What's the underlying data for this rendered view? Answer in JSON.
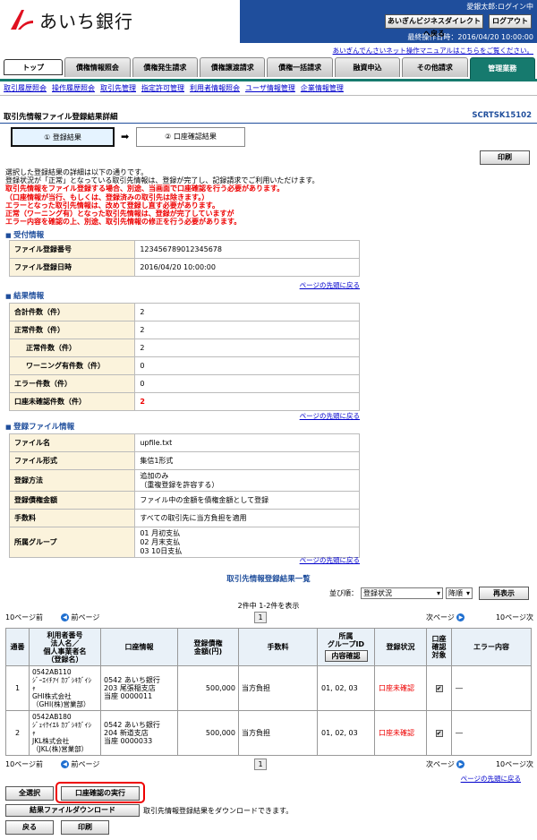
{
  "header": {
    "logo_text": "あいち銀行",
    "user": "愛銀太郎:ログイン中",
    "direct_btn": "あいぎんビジネスダイレクトへ戻る",
    "logout_btn": "ログアウト",
    "last_op": "最終操作日時：2016/04/20 10:00:00",
    "links": "あいぎんでんさいネット操作マニュアルはこちらをご覧ください。"
  },
  "tabs": [
    "トップ",
    "債権情報照会",
    "債権発生請求",
    "債権譲渡請求",
    "債権一括請求",
    "融資申込",
    "その他請求",
    "管理業務"
  ],
  "subnav": [
    "取引履歴照会",
    "操作履歴照会",
    "取引先管理",
    "指定許可管理",
    "利用者情報照会",
    "ユーザ情報管理",
    "企業情報管理"
  ],
  "page": {
    "title": "取引先情報ファイル登録結果詳細",
    "id": "SCRTSK15102",
    "step1": "① 登録結果",
    "step2": "② 口座確認結果",
    "print_btn": "印刷"
  },
  "intro": {
    "line1": "選択した登録結果の詳細は以下の通りです。",
    "line2": "登録状況が「正常」となっている取引先情報は、登録が完了し、記録請求でご利用いただけます。",
    "red1": "取引先情報をファイル登録する場合、別途、当画面で口座確認を行う必要があります。",
    "red2": "（口座情報が当行、もしくは、登録済みの取引先は除きます。）",
    "red3": "エラーとなった取引先情報は、改めて登録し直す必要があります。",
    "red4": "正常（ワーニング有）となった取引先情報は、登録が完了していますが",
    "red5": "エラー内容を確認の上、別途、取引先情報の修正を行う必要があります。"
  },
  "receipt": {
    "title": "受付情報",
    "rows": [
      {
        "k": "ファイル登録番号",
        "v": "123456789012345678"
      },
      {
        "k": "ファイル登録日時",
        "v": "2016/04/20 10:00:00"
      }
    ]
  },
  "top_link": "ページの先頭に戻る",
  "result": {
    "title": "結果情報",
    "rows": [
      {
        "k": "合計件数（件）",
        "v": "2"
      },
      {
        "k": "正常件数（件）",
        "v": "2"
      },
      {
        "k": "正常件数（件）",
        "v": "2"
      },
      {
        "k": "ワーニング有件数（件）",
        "v": "0"
      },
      {
        "k": "エラー件数（件）",
        "v": "0"
      },
      {
        "k": "口座未確認件数（件）",
        "v": "2"
      }
    ]
  },
  "file": {
    "title": "登録ファイル情報",
    "rows": [
      {
        "k": "ファイル名",
        "v": "upfile.txt"
      },
      {
        "k": "ファイル形式",
        "v": "集信1形式"
      },
      {
        "k": "登録方法",
        "v": "追加のみ",
        "v2": "（重複登録を許容する）"
      },
      {
        "k": "登録債権金額",
        "v": "ファイル中の金額を債権金額として登録"
      },
      {
        "k": "手数料",
        "v": "すべての取引先に当方負担を適用"
      },
      {
        "k": "所属グループ",
        "v": "01 月初支払",
        "v2": "02 月末支払",
        "v3": "03 10日支払"
      }
    ]
  },
  "list": {
    "title": "取引先情報登録結果一覧",
    "sort_label": "並び順：",
    "sort_value": "登録状況",
    "order_value": "降順",
    "resort_btn": "再表示",
    "count": "2件中 1-2件を表示",
    "prev10": "10ページ前",
    "prev": "前ページ",
    "page": "1",
    "next": "次ページ",
    "next10": "10ページ次",
    "headers": [
      "通番",
      "利用者番号\n法人名／\n個人事業者名\n（登録名）",
      "口座情報",
      "登録債権\n金額(円)",
      "手数料",
      "所属\nグループID",
      "登録状況",
      "口座\n確認\n対象",
      "エラー内容"
    ],
    "group_btn": "内容確認",
    "rows": [
      {
        "no": "1",
        "user": "0542AB110",
        "name1": "ｼﾞｰｴｲﾁｱｲ ｶﾌﾞｼｷｶﾞｲｼ",
        "name2": "ｬ",
        "name3": "GHI株式会社",
        "name4": "（GHI(株)営業部）",
        "acc1": "0542 あいち銀行",
        "acc2": "203 尾張稲支店",
        "acc3": "当座 0000011",
        "amount": "500,000",
        "fee": "当方負担",
        "group": "01, 02, 03",
        "status": "口座未確認",
        "err": "―"
      },
      {
        "no": "2",
        "user": "0542AB180",
        "name1": "ｼﾞｪｲｹｲｴﾙ ｶﾌﾞｼｷｶﾞｲｼ",
        "name2": "ｬ",
        "name3": "JKL株式会社",
        "name4": "（JKL(株)営業部）",
        "acc1": "0542 あいち銀行",
        "acc2": "204 新道支店",
        "acc3": "当座 0000033",
        "amount": "500,000",
        "fee": "当方負担",
        "group": "01, 02, 03",
        "status": "口座未確認",
        "err": "―"
      }
    ]
  },
  "footer": {
    "select_all": "全選択",
    "exec_btn": "口座確認の実行",
    "download_btn": "結果ファイルダウンロード",
    "download_note": "取引先情報登録結果をダウンロードできます。",
    "back_btn": "戻る",
    "print_btn": "印刷"
  },
  "colors": {
    "brand": "#1f4e9c",
    "tab_active": "#167a6e",
    "highlight": "#e00000"
  }
}
